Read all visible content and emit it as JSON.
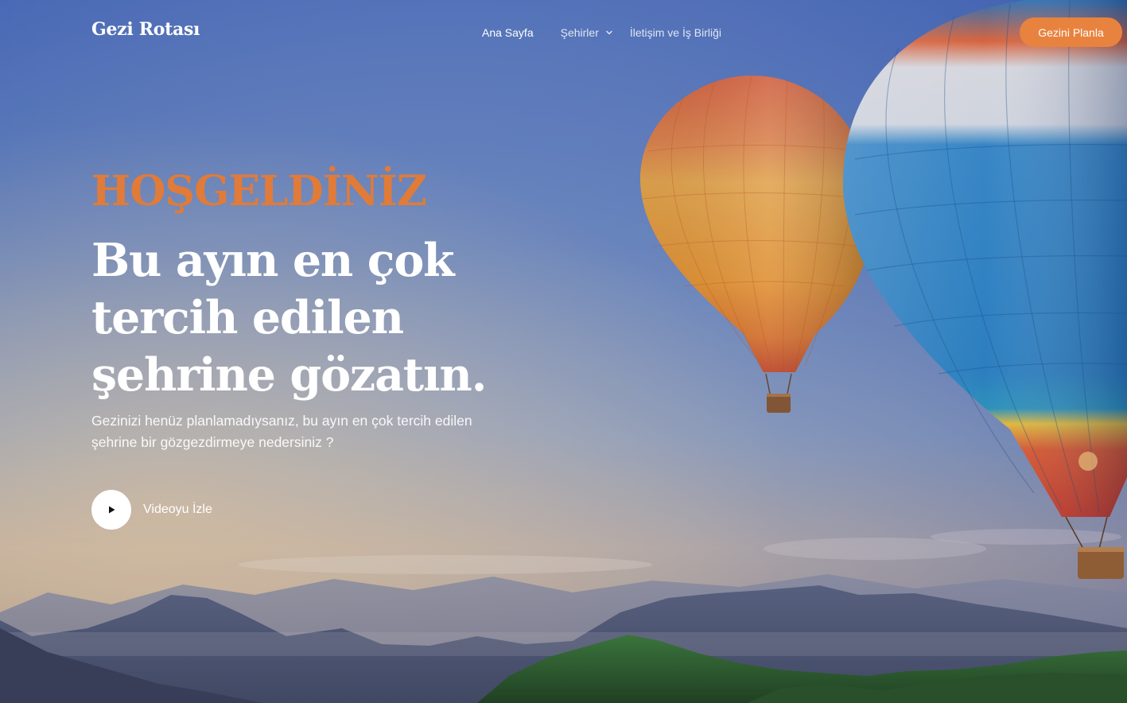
{
  "brand": {
    "logo_text": "Gezi Rotası",
    "accent_color": "#e8833f"
  },
  "nav": {
    "items": [
      {
        "label": "Ana Sayfa",
        "active": true
      },
      {
        "label": "Şehirler",
        "has_dropdown": true
      },
      {
        "label": "İletişim ve İş Birliği"
      }
    ],
    "cta_label": "Gezini Planla"
  },
  "hero": {
    "eyebrow": "HOŞGELDİNİZ",
    "headline": "Bu ayın en çok tercih edilen şehrine gözatın.",
    "subtext": "Gezinizi henüz planlamadıysanız, bu ayın en çok tercih edilen şehrine bir gözgezdirmeye nedersiniz ?",
    "video_label": "Videoyu İzle",
    "background": "hot-air-balloons-over-mountains"
  },
  "icons": {
    "play": "play-icon",
    "dropdown": "chevron-down-icon"
  }
}
